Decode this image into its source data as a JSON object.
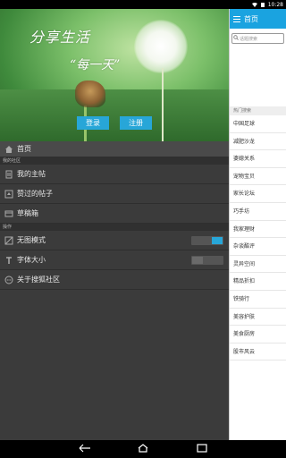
{
  "status_bar": {
    "time": "10:28",
    "icons": [
      "wifi-icon",
      "battery-icon"
    ]
  },
  "drawer": {
    "hero": {
      "title_line1": "分享生活",
      "title_line2": "“每一天”",
      "login_label": "登录",
      "register_label": "注册"
    },
    "home": {
      "label": "首页",
      "icon": "home-icon"
    },
    "my_community_header": "我的社区",
    "my_items": [
      {
        "label": "我的主帖",
        "icon": "document-icon"
      },
      {
        "label": "赞过的帖子",
        "icon": "like-icon"
      },
      {
        "label": "草稿箱",
        "icon": "drafts-icon"
      }
    ],
    "operation_header": "操作",
    "op_items": [
      {
        "label": "无图模式",
        "icon": "image-off-icon",
        "toggle": "on"
      },
      {
        "label": "字体大小",
        "icon": "font-size-icon",
        "toggle": "off"
      },
      {
        "label": "关于搜狐社区",
        "icon": "info-icon"
      }
    ]
  },
  "right_panel": {
    "title": "首页",
    "search_placeholder": "话题搜索",
    "hot_header": "热门搜索",
    "hot_items": [
      "中国足球",
      "减肥沙龙",
      "婆媳关系",
      "宠物宝贝",
      "家长论坛",
      "巧手坊",
      "我家理财",
      "杂谈酷评",
      "灵异空间",
      "精品折扣",
      "铁骑行",
      "美容护肤",
      "美食厨房",
      "股市风云"
    ]
  },
  "nav_bar": {
    "icons": [
      "back-icon",
      "home-nav-icon",
      "recents-icon"
    ]
  },
  "colors": {
    "accent": "#1aa3e0",
    "drawer_bg": "#3b3b3b"
  }
}
